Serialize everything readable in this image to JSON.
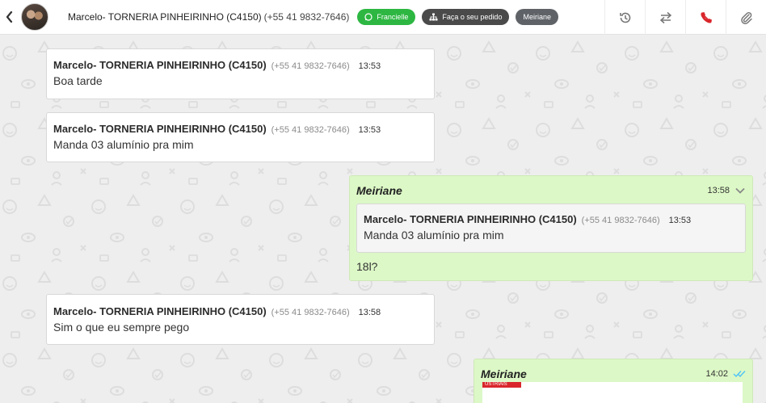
{
  "header": {
    "contact_name": "Marcelo- TORNERIA PINHEIRINHO (C4150)",
    "contact_phone": "(+55 41 9832-7646)",
    "tags": [
      {
        "label": "Francielle",
        "color": "#2db742",
        "icon": "whatsapp-icon"
      },
      {
        "label": "Faça o seu pedido",
        "color": "#4a4a4a",
        "icon": "sitemap-icon"
      },
      {
        "label": "Meiriane",
        "color": "#5f6368"
      }
    ],
    "actions": [
      "history-icon",
      "transfer-icon",
      "end-call-icon",
      "attach-icon"
    ]
  },
  "messages": [
    {
      "sender": "Marcelo- TORNERIA PINHEIRINHO (C4150)",
      "phone": "(+55 41 9832-7646)",
      "time": "13:53",
      "text": "Boa tarde"
    },
    {
      "sender": "Marcelo- TORNERIA PINHEIRINHO (C4150)",
      "phone": "(+55 41 9832-7646)",
      "time": "13:53",
      "text": "Manda 03 alumínio pra mim"
    },
    {
      "sender": "Meiriane",
      "time": "13:58",
      "quote": {
        "sender": "Marcelo- TORNERIA PINHEIRINHO (C4150)",
        "phone": "(+55 41 9832-7646)",
        "time": "13:53",
        "text": "Manda 03 alumínio pra mim"
      },
      "text": "18l?"
    },
    {
      "sender": "Marcelo- TORNERIA PINHEIRINHO (C4150)",
      "phone": "(+55 41 9832-7646)",
      "time": "13:58",
      "text": "Sim o que eu sempre pego"
    },
    {
      "sender": "Meiriane",
      "time": "14:02",
      "image_caption": "USTRIAIS"
    }
  ],
  "colors": {
    "outgoing": "#dcf8c6",
    "incoming": "#ffffff",
    "accent_green": "#2db742",
    "read_tick": "#4fc3f7"
  }
}
